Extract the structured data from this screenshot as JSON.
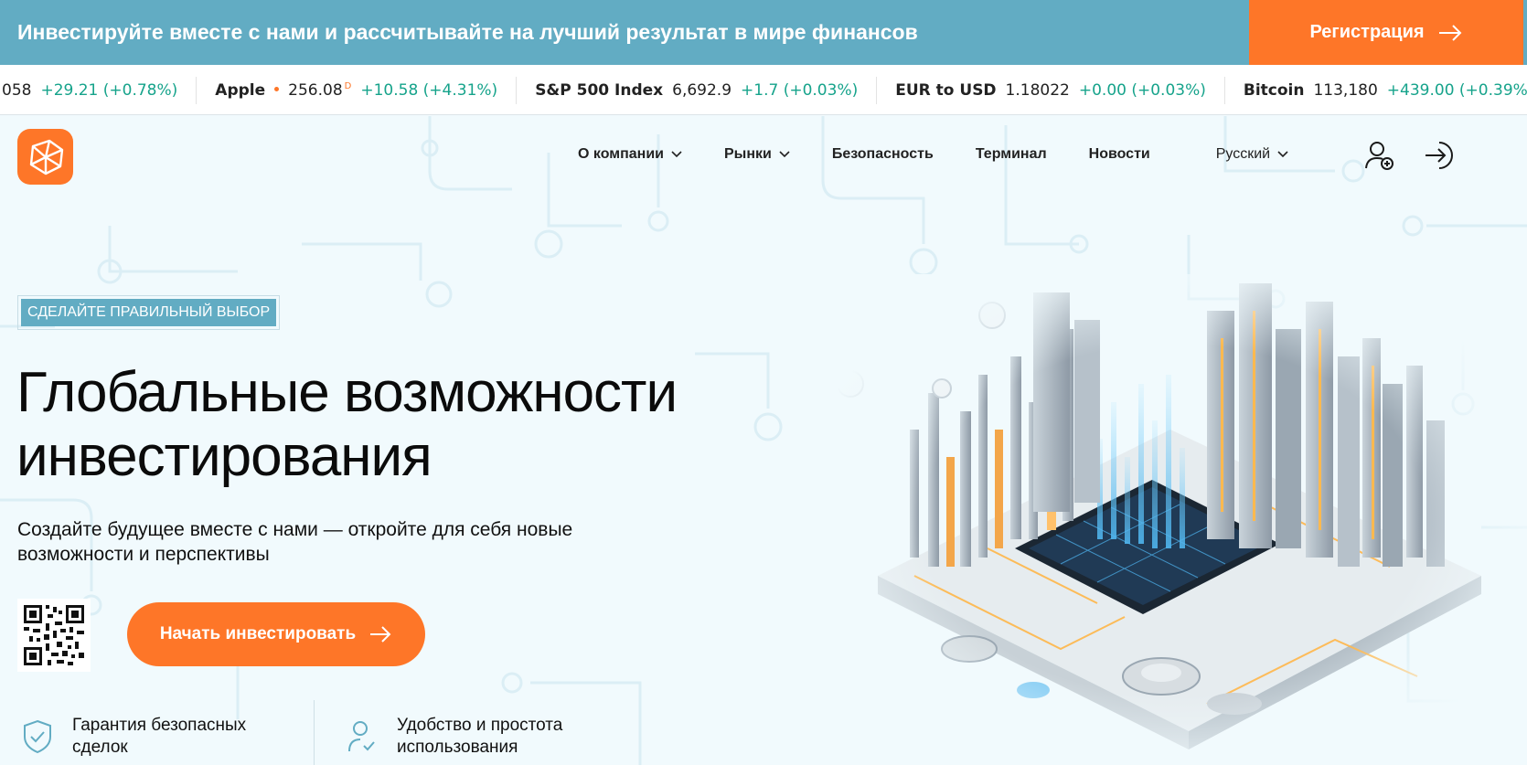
{
  "promo": {
    "text": "Инвестируйте вместе с нами и рассчитывайте на лучший результат в мире финансов",
    "register_label": "Регистрация"
  },
  "ticker": [
    {
      "name": "",
      "price": "058",
      "change": "+29.21 (+0.78%)",
      "dot": false,
      "sup": ""
    },
    {
      "name": "Apple",
      "price": "256.08",
      "change": "+10.58 (+4.31%)",
      "dot": true,
      "sup": "D"
    },
    {
      "name": "S&P 500 Index",
      "price": "6,692.9",
      "change": "+1.7 (+0.03%)",
      "dot": false,
      "sup": ""
    },
    {
      "name": "EUR to USD",
      "price": "1.18022",
      "change": "+0.00 (+0.03%)",
      "dot": false,
      "sup": ""
    },
    {
      "name": "Bitcoin",
      "price": "113,180",
      "change": "+439.00 (+0.39%)",
      "dot": false,
      "sup": ""
    }
  ],
  "nav": {
    "about": "О компании",
    "markets": "Рынки",
    "security": "Безопасность",
    "terminal": "Терминал",
    "news": "Новости",
    "language": "Русский"
  },
  "hero": {
    "badge": "СДЕЛАЙТЕ ПРАВИЛЬНЫЙ ВЫБОР",
    "title_line1": "Глобальные возможности",
    "title_line2": "инвестирования",
    "subtitle": "Создайте будущее вместе с нами — откройте для себя новые возможности и перспективы",
    "cta_label": "Начать инвестировать"
  },
  "features": [
    {
      "icon": "shield-check-icon",
      "line1": "Гарантия безопасных",
      "line2": "сделок"
    },
    {
      "icon": "user-check-icon",
      "line1": "Удобство и простота",
      "line2": "использования"
    }
  ],
  "colors": {
    "accent": "#fe7628",
    "promo_bg": "#62acc3",
    "positive": "#16a38b",
    "page_bg": "#f1fafd"
  }
}
